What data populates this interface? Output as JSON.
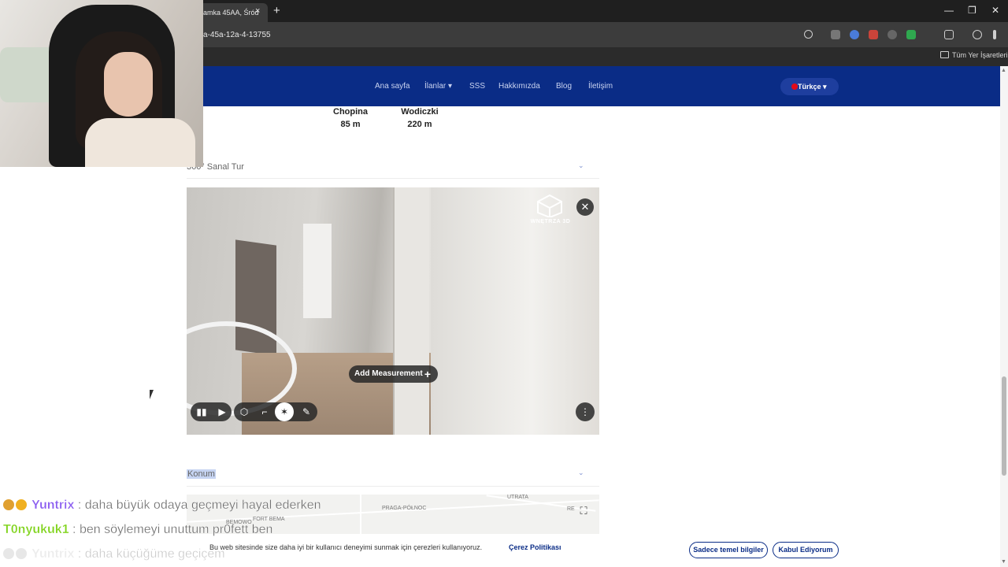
{
  "browser": {
    "tab_title": "amka 45AA, Śród",
    "tab_close": "×",
    "new_tab": "+",
    "url": "a-45a-12a-4-13755",
    "bookmarks_label": "Tüm Yer İşaretleri",
    "window_controls": [
      "—",
      "❐",
      "✕"
    ]
  },
  "nav": {
    "links": [
      "Ana sayfa",
      "İlanlar ▾",
      "SSS",
      "Hakkımızda",
      "Blog",
      "İletişim"
    ],
    "language": "Türkçe ▾"
  },
  "streets": [
    {
      "name": "Chopina",
      "distance": "85 m"
    },
    {
      "name": "Wodiczki",
      "distance": "220 m"
    }
  ],
  "sections": {
    "tour_title": "360° Sanal Tur",
    "location_title": "Konum"
  },
  "tour": {
    "logo_text": "WNĘTRZA 3D",
    "close": "✕",
    "add_measurement": "Add Measurement",
    "add_plus": "+",
    "more": "⋮",
    "controls": [
      "▮▮",
      "▶",
      "⬡",
      "⌐",
      "✶",
      "✎"
    ]
  },
  "map": {
    "labels": [
      "PRAGA-PÓŁNOC",
      "BEMOWO",
      "FORT BEMA",
      "UTRATA",
      "RE"
    ],
    "fullscreen": "⛶"
  },
  "cookie": {
    "text": "Bu web sitesinde size daha iyi bir kullanıcı deneyimi sunmak için çerezleri kullanıyoruz.",
    "policy_link": "Çerez Politikası",
    "essential_button": "Sadece temel bilgiler",
    "accept_button": "Kabul Ediyorum"
  },
  "chat": [
    {
      "user": "Yuntrix",
      "message": ": daha büyük odaya geçmeyi hayal ederken",
      "color": "#8a5cf0"
    },
    {
      "user": "T0nyukuk1",
      "message": ": ben söylemeyi unuttum pr0fett ben",
      "color": "#7fd31a"
    },
    {
      "user": "Yuntrix",
      "message": ": daha küçüğüme geçiçem",
      "color": "#c9c9c9"
    }
  ]
}
